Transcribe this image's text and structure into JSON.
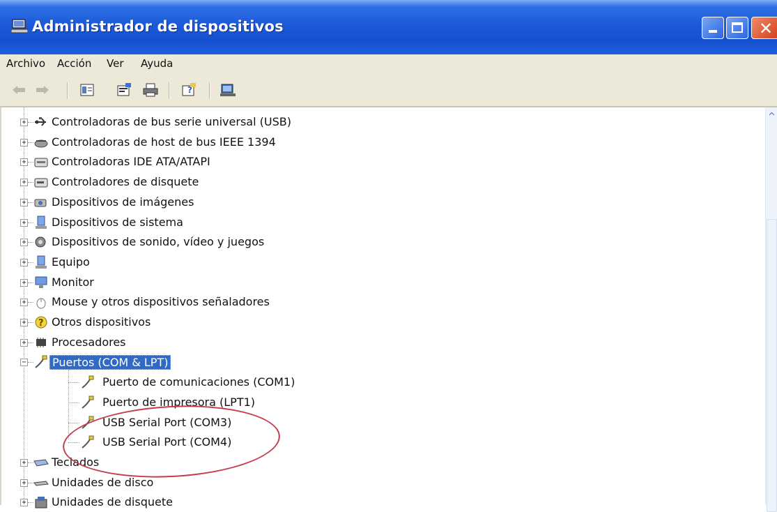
{
  "window": {
    "title": "Administrador de dispositivos"
  },
  "menu": [
    "Archivo",
    "Acción",
    "Ver",
    "Ayuda"
  ],
  "toolbar": {
    "buttons": [
      "back-icon",
      "forward-icon",
      "view-icon",
      "properties-icon",
      "print-icon",
      "help-icon",
      "scan-hardware-icon"
    ]
  },
  "tree": {
    "items": [
      {
        "label": "Controladoras de bus serie universal (USB)",
        "icon": "usb-icon",
        "expander": "+"
      },
      {
        "label": "Controladoras de host de bus IEEE 1394",
        "icon": "ieee1394-icon",
        "expander": "+"
      },
      {
        "label": "Controladoras IDE ATA/ATAPI",
        "icon": "ide-controller-icon",
        "expander": "+"
      },
      {
        "label": "Controladores de disquete",
        "icon": "floppy-controller-icon",
        "expander": "+"
      },
      {
        "label": "Dispositivos de imágenes",
        "icon": "camera-icon",
        "expander": "+"
      },
      {
        "label": "Dispositivos de sistema",
        "icon": "system-device-icon",
        "expander": "+"
      },
      {
        "label": "Dispositivos de sonido, vídeo y juegos",
        "icon": "sound-icon",
        "expander": "+"
      },
      {
        "label": "Equipo",
        "icon": "computer-icon",
        "expander": "+"
      },
      {
        "label": "Monitor",
        "icon": "monitor-icon",
        "expander": "+"
      },
      {
        "label": "Mouse y otros dispositivos señaladores",
        "icon": "mouse-icon",
        "expander": "+"
      },
      {
        "label": "Otros dispositivos",
        "icon": "unknown-device-icon",
        "expander": "+"
      },
      {
        "label": "Procesadores",
        "icon": "processor-icon",
        "expander": "+"
      },
      {
        "label": "Puertos (COM & LPT)",
        "icon": "port-icon",
        "expander": "−",
        "selected": true
      },
      {
        "label": "Puerto de comunicaciones (COM1)",
        "icon": "port-icon",
        "child": true
      },
      {
        "label": "Puerto de impresora (LPT1)",
        "icon": "port-icon",
        "child": true
      },
      {
        "label": "USB Serial Port (COM3)",
        "icon": "port-icon",
        "child": true
      },
      {
        "label": "USB Serial Port (COM4)",
        "icon": "port-icon",
        "child": true
      },
      {
        "label": "Teclados",
        "icon": "keyboard-icon",
        "expander": "+"
      },
      {
        "label": "Unidades de disco",
        "icon": "disk-drive-icon",
        "expander": "+"
      },
      {
        "label": "Unidades de disquete",
        "icon": "floppy-drive-icon",
        "expander": "+"
      }
    ]
  },
  "colors": {
    "titlebar": "#1b5ad8",
    "selection": "#316ac5",
    "annotation": "#c23d4d"
  }
}
